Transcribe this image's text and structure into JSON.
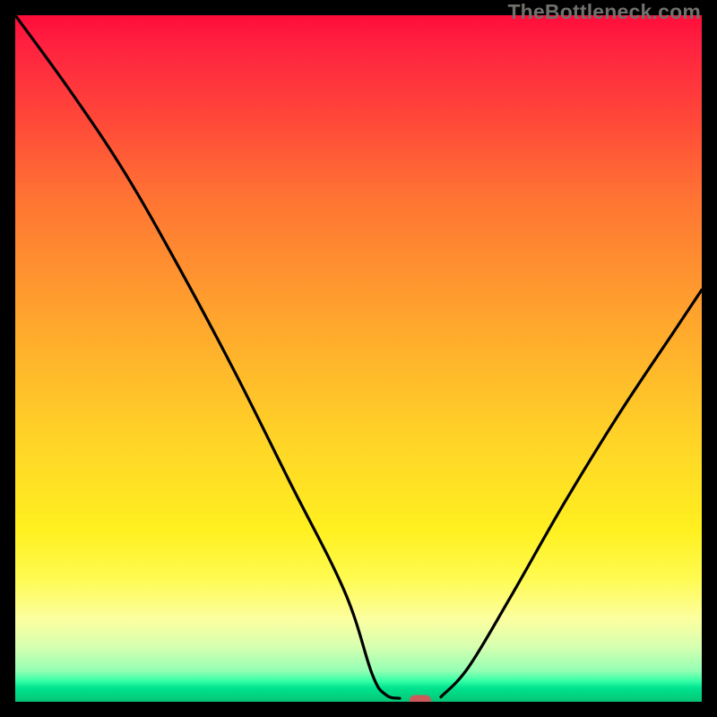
{
  "attribution": "TheBottleneck.com",
  "chart_data": {
    "type": "line",
    "title": "",
    "xlabel": "",
    "ylabel": "",
    "xlim": [
      0,
      100
    ],
    "ylim": [
      0,
      100
    ],
    "curve_left": [
      {
        "x": 0,
        "y": 100
      },
      {
        "x": 8,
        "y": 89
      },
      {
        "x": 16,
        "y": 77
      },
      {
        "x": 24,
        "y": 63
      },
      {
        "x": 32,
        "y": 48
      },
      {
        "x": 40,
        "y": 32
      },
      {
        "x": 48,
        "y": 16
      },
      {
        "x": 52,
        "y": 4
      },
      {
        "x": 54,
        "y": 1
      },
      {
        "x": 56,
        "y": 0.5
      }
    ],
    "curve_right": [
      {
        "x": 62,
        "y": 0.7
      },
      {
        "x": 66,
        "y": 5
      },
      {
        "x": 72,
        "y": 15
      },
      {
        "x": 80,
        "y": 29
      },
      {
        "x": 88,
        "y": 42
      },
      {
        "x": 96,
        "y": 54
      },
      {
        "x": 100,
        "y": 60
      }
    ],
    "minimum_marker": {
      "x": 59,
      "y": 0.2
    },
    "colors": {
      "top": "#ff0d3a",
      "mid": "#ffe424",
      "bottom": "#05c576",
      "curve": "#000000",
      "marker": "#cc5c5c"
    }
  }
}
